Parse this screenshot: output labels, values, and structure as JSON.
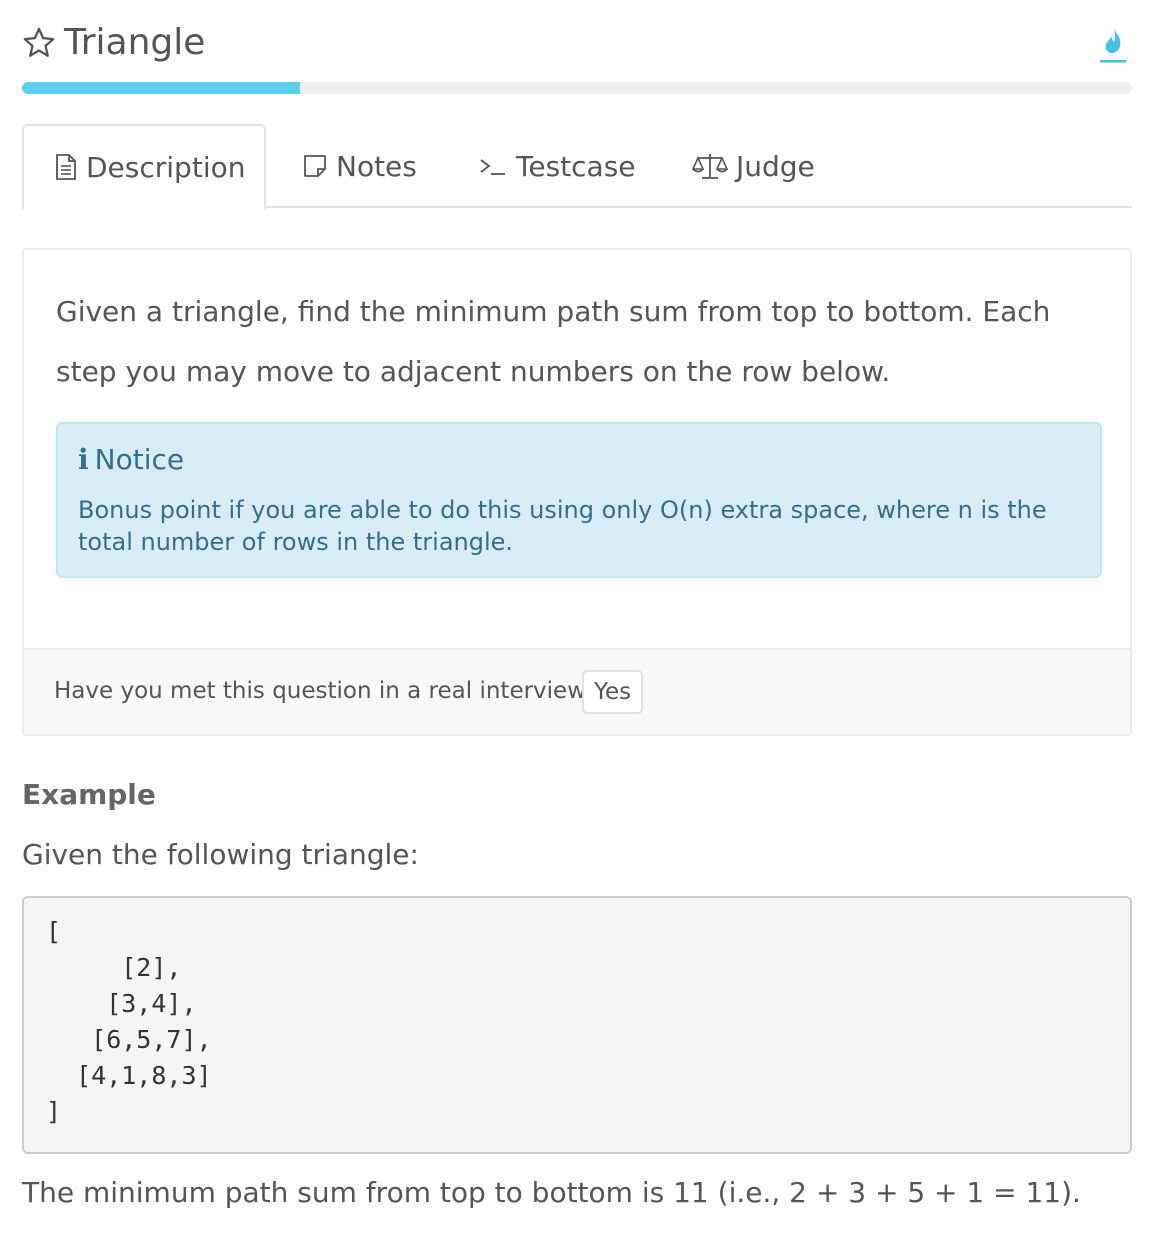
{
  "header": {
    "title": "Triangle",
    "star_icon": "star-outline-icon",
    "fire_icon": "flame-icon",
    "accent_color": "#5ecfee"
  },
  "progress": {
    "fraction": 0.25
  },
  "tabs": [
    {
      "label": "Description",
      "icon": "document-icon",
      "active": true
    },
    {
      "label": "Notes",
      "icon": "note-icon",
      "active": false
    },
    {
      "label": "Testcase",
      "icon": "terminal-icon",
      "active": false
    },
    {
      "label": "Judge",
      "icon": "balance-scale-icon",
      "active": false
    }
  ],
  "problem": {
    "description": "Given a triangle, find the minimum path sum from top to bottom. Each step you may move to adjacent numbers on the row below.",
    "notice_title": "Notice",
    "notice_body": "Bonus point if you are able to do this using only O(n) extra space, where n is the total number of rows in the triangle.",
    "interview_question": "Have you met this question in a real interview?",
    "yes_label": "Yes"
  },
  "example": {
    "heading": "Example",
    "intro": "Given the following triangle:",
    "code": "[\n     [2],\n    [3,4],\n   [6,5,7],\n  [4,1,8,3]\n]",
    "result": "The minimum path sum from top to bottom is 11 (i.e., 2 + 3 + 5 + 1 = 11)."
  }
}
